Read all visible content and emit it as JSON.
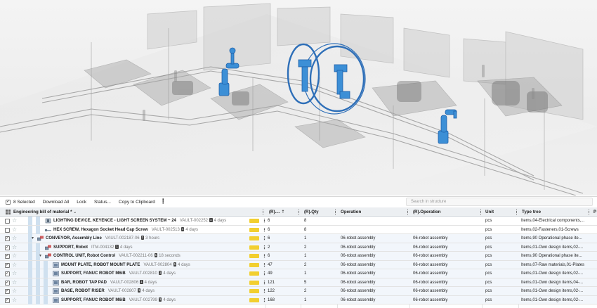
{
  "toolbar": {
    "selected": "8 Selected",
    "download": "Download All",
    "lock": "Lock",
    "status": "Status...",
    "clipboard": "Copy to Clipboard",
    "more": "⋮"
  },
  "search": {
    "placeholder": "Search in structure"
  },
  "columns": {
    "name": "Engineering bill of material *",
    "rpos": "(R)....",
    "rqty": "(R).Qty",
    "operation": "Operation",
    "roperation": "(R).Operation",
    "unit": "Unit",
    "typetree": "Type tree",
    "extra": "P"
  },
  "rows": [
    {
      "checked": false,
      "title": "LIGHTING DEVICE, KEYENCE - LIGHT SCREEN SYSTEM ~ 24",
      "id": "VAULT-002252",
      "ver": "1",
      "age": "4 days",
      "rpos": "6",
      "rqty": "8",
      "operation": "",
      "roperation": "",
      "unit": "pcs",
      "type": "Items,04-Electrical components,...",
      "level": 2,
      "exp": "",
      "icon": "device"
    },
    {
      "checked": false,
      "title": "HEX SCREW, Hexagon Socket Head Cap Screw",
      "id": "VAULT-002513",
      "ver": "1",
      "age": "4 days",
      "rpos": "6",
      "rqty": "8",
      "operation": "",
      "roperation": "",
      "unit": "pcs",
      "type": "Items,02-Fasteners,01-Screws",
      "level": 2,
      "exp": "",
      "icon": "screw"
    },
    {
      "checked": true,
      "title": "CONVEYOR, Assembly Line",
      "id": "VAULT-002187-06",
      "ver": "1",
      "age": "3 hours",
      "rpos": "6",
      "rqty": "1",
      "operation": "06-robot assembly",
      "roperation": "06-robot assembly",
      "unit": "pcs",
      "type": "Items,90 Operational phase ite...",
      "level": 1,
      "exp": "▾",
      "icon": "assembly"
    },
    {
      "checked": true,
      "title": "SUPPORT, Robot",
      "id": "ITM-004132",
      "ver": "1",
      "age": "4 days",
      "rpos": "2",
      "rqty": "2",
      "operation": "06-robot assembly",
      "roperation": "06-robot assembly",
      "unit": "pcs",
      "type": "Items,01-Own design items,02-...",
      "level": 2,
      "exp": "",
      "icon": "assembly"
    },
    {
      "checked": true,
      "title": "CONTROL UNIT, Robot Control",
      "id": "VAULT-002211-06",
      "ver": "1",
      "age": "18 seconds",
      "rpos": "6",
      "rqty": "1",
      "operation": "06-robot assembly",
      "roperation": "06-robot assembly",
      "unit": "pcs",
      "type": "Items,90 Operational phase ite...",
      "level": 2,
      "exp": "▾",
      "icon": "assembly"
    },
    {
      "checked": true,
      "title": "MOUNT PLATE, ROBOT MOUNT PLATE",
      "id": "VAULT-002804",
      "ver": "1",
      "age": "4 days",
      "rpos": "47",
      "rqty": "2",
      "operation": "06-robot assembly",
      "roperation": "06-robot assembly",
      "unit": "pcs",
      "type": "Items,07-Raw materials,01-Plates",
      "level": 3,
      "exp": "",
      "icon": "part"
    },
    {
      "checked": true,
      "title": "SUPPORT, FANUC ROBOT M6iB",
      "id": "VAULT-002810",
      "ver": "1",
      "age": "4 days",
      "rpos": "49",
      "rqty": "1",
      "operation": "06-robot assembly",
      "roperation": "06-robot assembly",
      "unit": "pcs",
      "type": "Items,01-Own design items,02-...",
      "level": 3,
      "exp": "",
      "icon": "part"
    },
    {
      "checked": true,
      "title": "BAR, ROBOT TAP PAD",
      "id": "VAULT-002806",
      "ver": "1",
      "age": "4 days",
      "rpos": "121",
      "rqty": "5",
      "operation": "06-robot assembly",
      "roperation": "06-robot assembly",
      "unit": "pcs",
      "type": "Items,01-Own design items,04-...",
      "level": 3,
      "exp": "",
      "icon": "part"
    },
    {
      "checked": true,
      "title": "BASE, ROBOT RISER",
      "id": "VAULT-002807",
      "ver": "1",
      "age": "4 days",
      "rpos": "122",
      "rqty": "2",
      "operation": "06-robot assembly",
      "roperation": "06-robot assembly",
      "unit": "pcs",
      "type": "Items,01-Own design items,02-...",
      "level": 3,
      "exp": "",
      "icon": "part"
    },
    {
      "checked": true,
      "title": "SUPPORT, FANUC ROBOT M6iB",
      "id": "VAULT-002799",
      "ver": "1",
      "age": "4 days",
      "rpos": "168",
      "rqty": "1",
      "operation": "06-robot assembly",
      "roperation": "06-robot assembly",
      "unit": "pcs",
      "type": "Items,01-Own design items,02-...",
      "level": 3,
      "exp": "",
      "icon": "part"
    }
  ],
  "colors": {
    "robot": "#3c8fd6",
    "robot_dark": "#1e5fa8",
    "maturity": "#f2cf2f",
    "tree": "#cfe0ef",
    "header_bg": "#eceff2"
  },
  "icons": {
    "select_all": "checkbox-icon",
    "more": "vertical-dots-icon",
    "columns": "grid-icon",
    "dropdown": "chevron-down-icon",
    "sort": "arrow-up-icon",
    "star": "star-icon"
  }
}
